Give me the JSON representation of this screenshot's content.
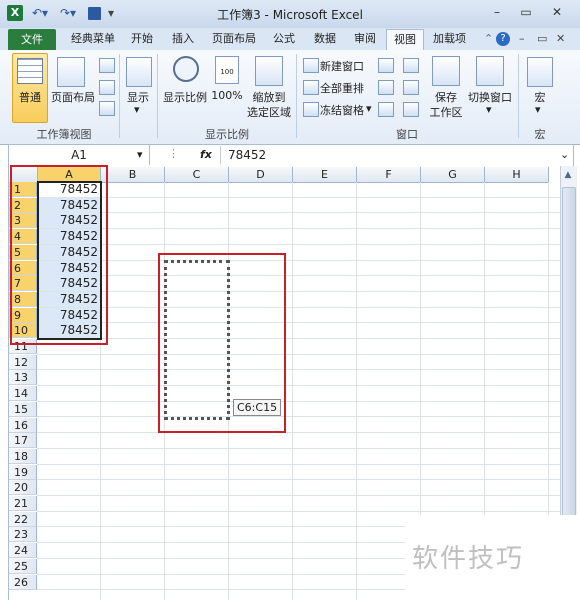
{
  "title": "工作簿3 - Microsoft Excel",
  "tabs": {
    "file": "文件",
    "items": [
      "经典菜单",
      "开始",
      "插入",
      "页面布局",
      "公式",
      "数据",
      "审阅",
      "视图",
      "加载项"
    ]
  },
  "ribbon": {
    "workbook_views": {
      "normal": "普通",
      "page_layout": "页面布局",
      "group_label": "工作簿视图"
    },
    "show": {
      "label": "显示"
    },
    "zoom": {
      "zoom": "显示比例",
      "hundred": "100%",
      "zoom_to_selection_line1": "缩放到",
      "zoom_to_selection_line2": "选定区域",
      "group_label": "显示比例"
    },
    "window": {
      "new_window": "新建窗口",
      "arrange_all": "全部重排",
      "freeze_panes": "冻结窗格",
      "save_workspace_line1": "保存",
      "save_workspace_line2": "工作区",
      "switch_windows": "切换窗口",
      "group_label": "窗口"
    },
    "macros": {
      "label": "宏",
      "group_label": "宏"
    }
  },
  "formula_bar": {
    "name_box": "A1",
    "fx": "fx",
    "value": "78452"
  },
  "grid": {
    "columns": [
      "A",
      "B",
      "C",
      "D",
      "E",
      "F",
      "G",
      "H"
    ],
    "rows": [
      "1",
      "2",
      "3",
      "4",
      "5",
      "6",
      "7",
      "8",
      "9",
      "10",
      "11",
      "12",
      "13",
      "14",
      "15",
      "16",
      "17",
      "18",
      "19",
      "20",
      "21",
      "22",
      "23",
      "24",
      "25",
      "26"
    ],
    "column_a_values": [
      "78452",
      "78452",
      "78452",
      "78452",
      "78452",
      "78452",
      "78452",
      "78452",
      "78452",
      "78452"
    ]
  },
  "drag_tooltip": "C6:C15",
  "watermark": "软件技巧",
  "colors": {
    "file_tab": "#2a7d3d",
    "selection_fill": "#dbe8f7",
    "highlight_header": "#f8d26a",
    "annotation_red": "#c8202a"
  }
}
